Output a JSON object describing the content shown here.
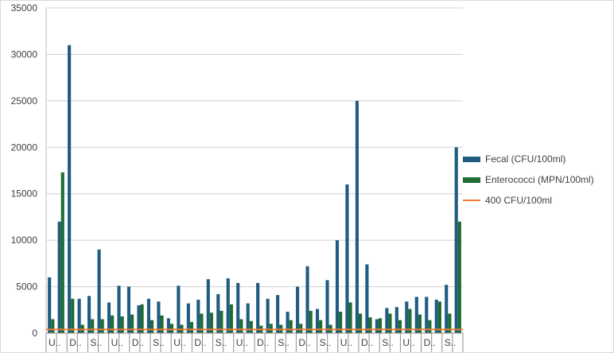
{
  "colors": {
    "fecal": "#1f5c7f",
    "entero": "#1e6b33",
    "threshold": "#ee7d31",
    "grid": "#d0d0d0",
    "axis_text": "#404040"
  },
  "chart_data": {
    "type": "bar",
    "title": "",
    "xlabel": "",
    "ylabel": "",
    "ylim": [
      0,
      35000
    ],
    "yticks": [
      0,
      5000,
      10000,
      15000,
      20000,
      25000,
      30000,
      35000
    ],
    "ytick_labels": [
      "0",
      "5000",
      "10000",
      "15000",
      "20000",
      "25000",
      "30000",
      "35000"
    ],
    "grid": true,
    "legend_position": "right",
    "categories": [
      "U..",
      "",
      "D..",
      "",
      "S..",
      "",
      "U..",
      "",
      "D..",
      "",
      "S..",
      "",
      "U..",
      "",
      "D..",
      "",
      "S..",
      "",
      "U..",
      "",
      "D..",
      "",
      "S..",
      "",
      "D..",
      "",
      "S..",
      "",
      "U..",
      "",
      "D..",
      "",
      "S..",
      "",
      "U..",
      "",
      "D..",
      "",
      "S..",
      ""
    ],
    "series": [
      {
        "name": "Fecal (CFU/100ml)",
        "type": "bar",
        "values": [
          6000,
          12000,
          31000,
          3700,
          4000,
          9000,
          3300,
          5100,
          5000,
          3000,
          3700,
          3400,
          1600,
          5100,
          3200,
          3600,
          5800,
          4200,
          5900,
          5400,
          3200,
          5400,
          3700,
          4100,
          2300,
          5000,
          7200,
          2600,
          5700,
          10000,
          16000,
          25000,
          7400,
          1500,
          2700,
          2800,
          3400,
          3900,
          3900,
          3600,
          5200,
          20000
        ]
      },
      {
        "name": "Enterococci (MPN/100ml)",
        "type": "bar",
        "values": [
          1500,
          17300,
          3700,
          900,
          1500,
          1500,
          1900,
          1800,
          2000,
          3100,
          1400,
          1900,
          1000,
          900,
          1200,
          2100,
          2200,
          2400,
          3100,
          1500,
          1300,
          800,
          1000,
          900,
          1400,
          1000,
          2400,
          1400,
          900,
          2300,
          3300,
          2100,
          1700,
          1600,
          2100,
          1400,
          2600,
          2000,
          1400,
          3400,
          2100,
          12000
        ]
      },
      {
        "name": "400 CFU/100ml",
        "type": "line",
        "value": 400
      }
    ]
  }
}
